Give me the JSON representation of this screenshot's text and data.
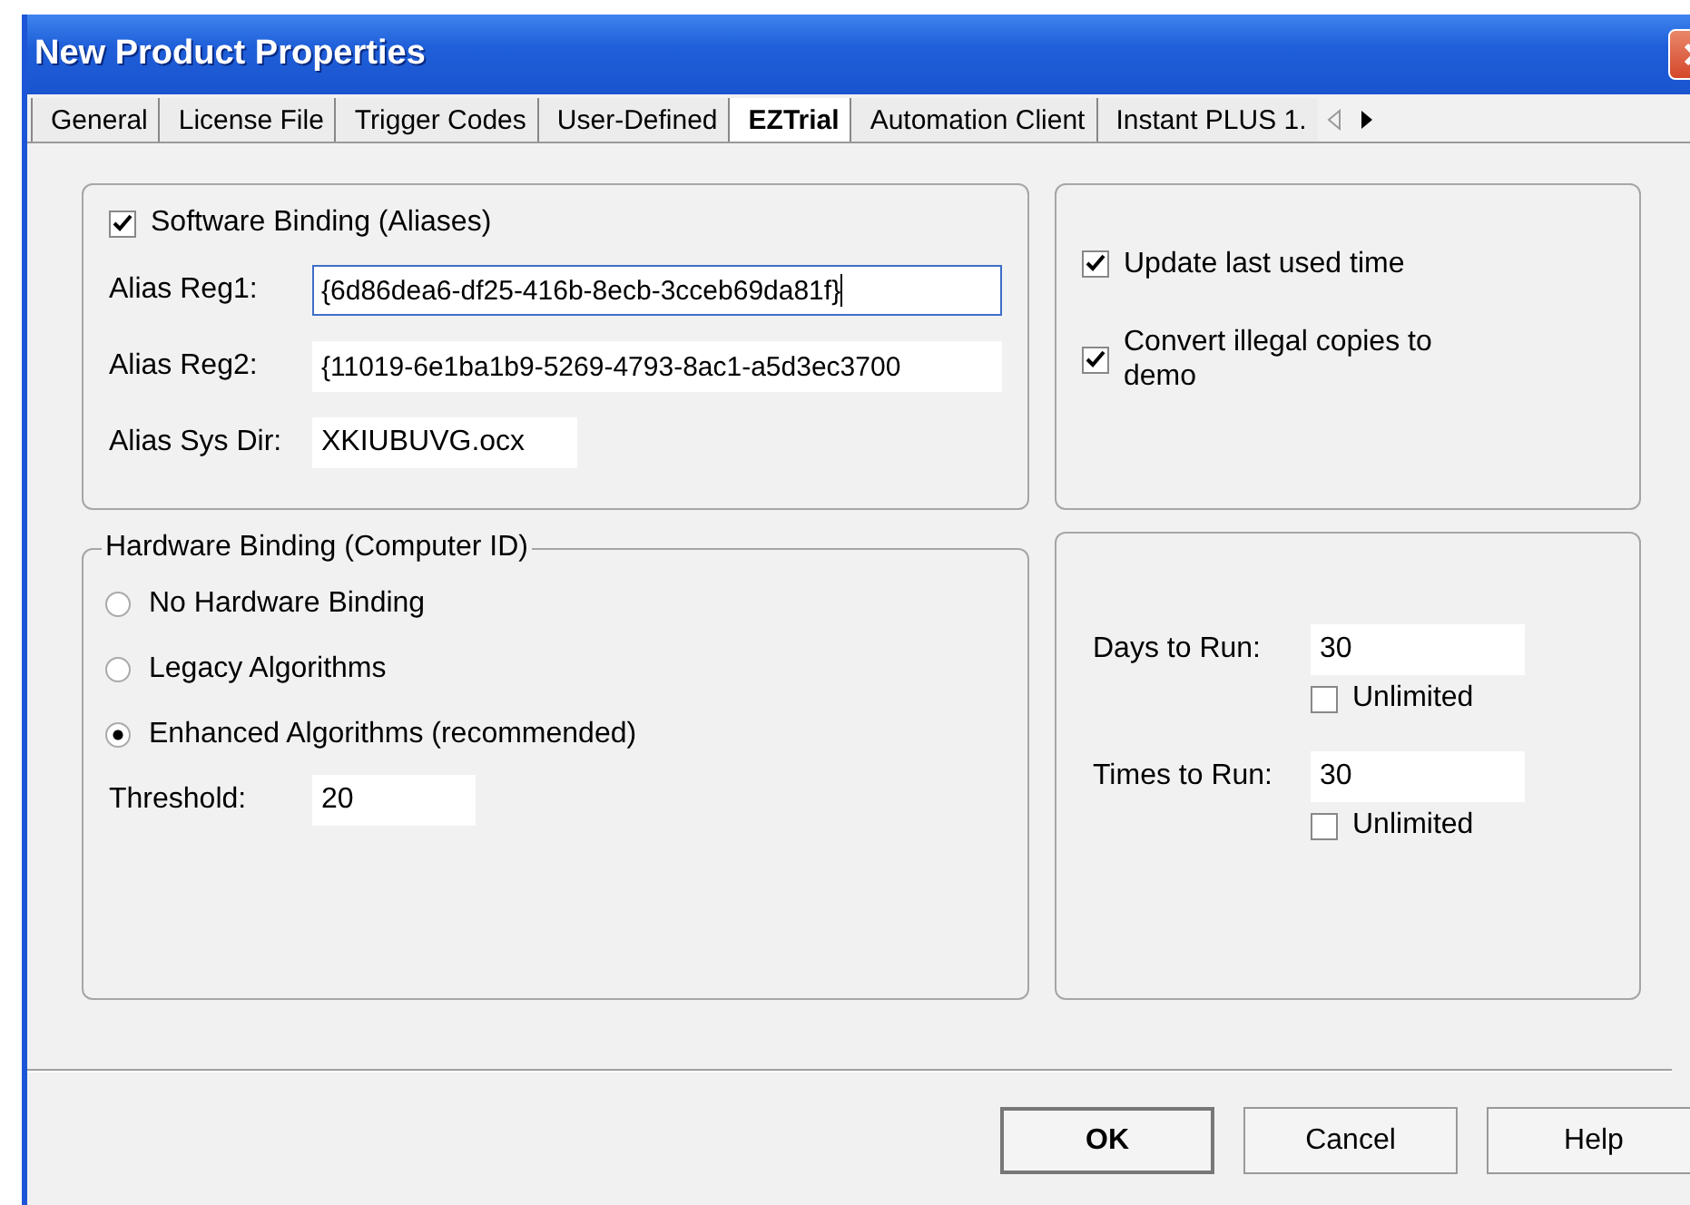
{
  "window": {
    "title": "New Product Properties"
  },
  "tabs": [
    {
      "label": "General",
      "selected": false
    },
    {
      "label": "License File",
      "selected": false
    },
    {
      "label": "Trigger Codes",
      "selected": false
    },
    {
      "label": "User-Defined",
      "selected": false
    },
    {
      "label": "EZTrial",
      "selected": true
    },
    {
      "label": "Automation Client",
      "selected": false
    },
    {
      "label": "Instant PLUS 1.",
      "selected": false
    }
  ],
  "software_binding": {
    "label": "Software Binding (Aliases)",
    "checked": true,
    "fields": [
      {
        "label": "Alias Reg1:",
        "value": "{6d86dea6-df25-416b-8ecb-3cceb69da81f}",
        "focused": true,
        "wide": true
      },
      {
        "label": "Alias Reg2:",
        "value": "{11019-6e1ba1b9-5269-4793-8ac1-a5d3ec3700",
        "focused": false,
        "wide": true
      },
      {
        "label": "Alias Sys Dir:",
        "value": "XKIUBUVG.ocx",
        "focused": false,
        "wide": false
      }
    ]
  },
  "hardware_binding": {
    "title": "Hardware Binding (Computer ID)",
    "options": [
      {
        "label": "No Hardware Binding",
        "selected": false
      },
      {
        "label": "Legacy Algorithms",
        "selected": false
      },
      {
        "label": "Enhanced Algorithms (recommended)",
        "selected": true
      }
    ],
    "threshold": {
      "label": "Threshold:",
      "value": "20"
    }
  },
  "options": [
    {
      "label": "Update last used time",
      "checked": true
    },
    {
      "label": "Convert illegal copies to demo",
      "checked": true
    }
  ],
  "run_limits": [
    {
      "label": "Days to Run:",
      "value": "30",
      "unlimited": {
        "label": "Unlimited",
        "checked": false
      }
    },
    {
      "label": "Times to Run:",
      "value": "30",
      "unlimited": {
        "label": "Unlimited",
        "checked": false
      }
    }
  ],
  "buttons": [
    {
      "label": "OK",
      "default": true
    },
    {
      "label": "Cancel",
      "default": false
    },
    {
      "label": "Help",
      "default": false
    }
  ]
}
